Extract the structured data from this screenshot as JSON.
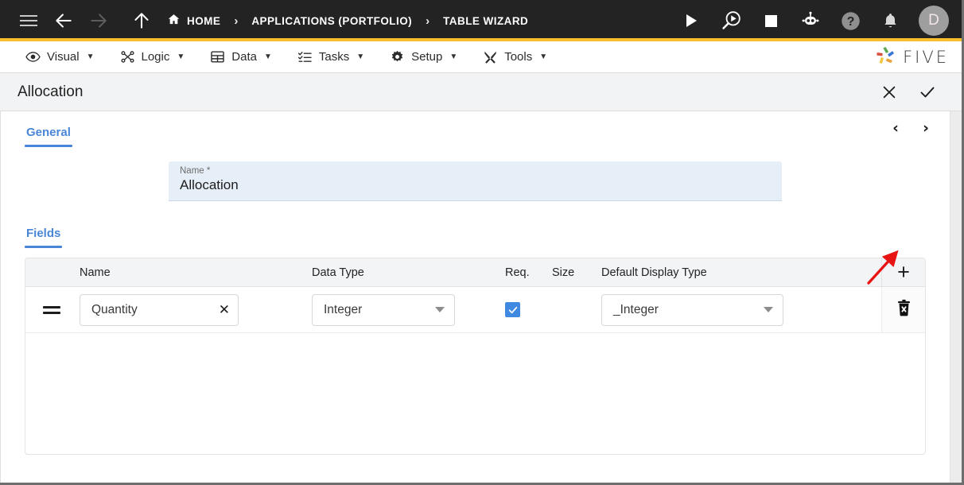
{
  "topbar": {
    "menu_icon": "hamburger-icon",
    "back_icon": "arrow-left-icon",
    "forward_icon": "arrow-right-icon",
    "up_icon": "arrow-up-icon",
    "breadcrumbs": [
      {
        "label": "HOME",
        "icon": "home-icon"
      },
      {
        "label": "APPLICATIONS (PORTFOLIO)",
        "icon": ""
      },
      {
        "label": "TABLE WIZARD",
        "icon": ""
      }
    ],
    "separator": "›",
    "actions": [
      {
        "name": "run-icon",
        "label": "Run"
      },
      {
        "name": "debug-icon",
        "label": "Debug"
      },
      {
        "name": "stop-icon",
        "label": "Stop"
      },
      {
        "name": "bot-icon",
        "label": "Assistant"
      },
      {
        "name": "help-icon",
        "label": "?"
      },
      {
        "name": "notifications-icon",
        "label": "Notifications"
      }
    ],
    "avatar_initial": "D",
    "accent_color": "#f7bd2b",
    "background_color": "#232323"
  },
  "menubar": {
    "items": [
      {
        "label": "Visual",
        "icon": "eye-icon",
        "caret": "▼"
      },
      {
        "label": "Logic",
        "icon": "logic-nodes-icon",
        "caret": "▼"
      },
      {
        "label": "Data",
        "icon": "table-grid-icon",
        "caret": "▼"
      },
      {
        "label": "Tasks",
        "icon": "checklist-icon",
        "caret": "▼"
      },
      {
        "label": "Setup",
        "icon": "gear-icon",
        "caret": "▼"
      },
      {
        "label": "Tools",
        "icon": "tools-icon",
        "caret": "▼"
      }
    ],
    "brand": "FIVE"
  },
  "titlebar": {
    "title": "Allocation",
    "close_label": "✕",
    "confirm_label": "✓"
  },
  "form": {
    "section_tab": "General",
    "pager": {
      "prev": "‹",
      "next": "›"
    },
    "name": {
      "label": "Name *",
      "value": "Allocation"
    }
  },
  "fields": {
    "section_tab": "Fields",
    "add_label": "+",
    "columns": [
      {
        "key": "handle",
        "label": ""
      },
      {
        "key": "name",
        "label": "Name"
      },
      {
        "key": "data_type",
        "label": "Data Type"
      },
      {
        "key": "req",
        "label": "Req."
      },
      {
        "key": "size",
        "label": "Size"
      },
      {
        "key": "default_display_type",
        "label": "Default Display Type"
      }
    ],
    "rows": [
      {
        "name": "Quantity",
        "clear_label": "✕",
        "data_type": "Integer",
        "req": true,
        "size": "",
        "default_display_type": "_Integer",
        "delete_icon": "trash-delete-icon"
      }
    ]
  },
  "annotation": {
    "arrow_color": "#e81313",
    "points_to": "next-record-button"
  }
}
